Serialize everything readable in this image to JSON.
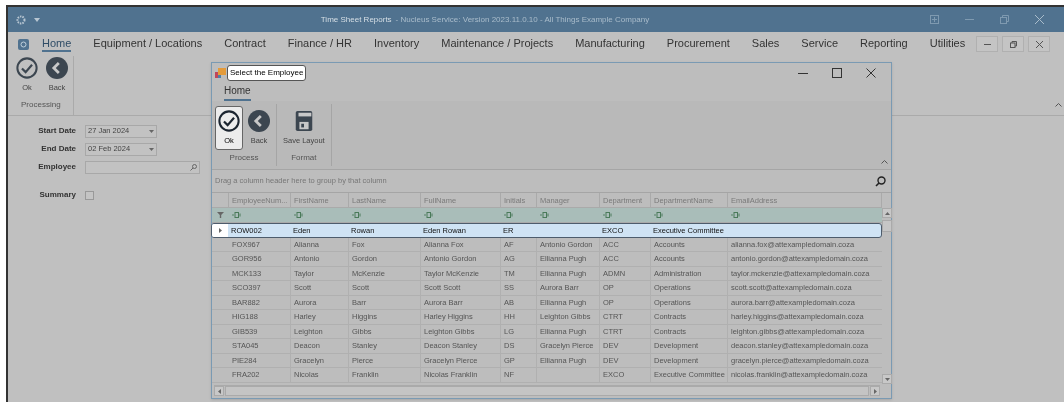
{
  "window": {
    "title": "Time Sheet Reports",
    "subtitle": "- Nucleus Service: Version 2023.11.0.10 - All Things Example Company"
  },
  "menu": [
    {
      "label": "Home",
      "selected": true
    },
    {
      "label": "Equipment / Locations",
      "selected": false
    },
    {
      "label": "Contract",
      "selected": false
    },
    {
      "label": "Finance / HR",
      "selected": false
    },
    {
      "label": "Inventory",
      "selected": false
    },
    {
      "label": "Maintenance / Projects",
      "selected": false
    },
    {
      "label": "Manufacturing",
      "selected": false
    },
    {
      "label": "Procurement",
      "selected": false
    },
    {
      "label": "Sales",
      "selected": false
    },
    {
      "label": "Service",
      "selected": false
    },
    {
      "label": "Reporting",
      "selected": false
    },
    {
      "label": "Utilities",
      "selected": false
    }
  ],
  "ribbon": {
    "buttons": [
      {
        "kind": "ok",
        "label": "Ok"
      },
      {
        "kind": "back",
        "label": "Back"
      }
    ],
    "group": "Processing"
  },
  "form": {
    "fields": [
      {
        "kind": "date",
        "label": "Start Date",
        "value": "27 Jan 2024"
      },
      {
        "kind": "date",
        "label": "End Date",
        "value": "02 Feb 2024"
      },
      {
        "kind": "search",
        "label": "Employee"
      },
      {
        "kind": "checkbox",
        "label": "Summary",
        "checked": false
      }
    ]
  },
  "dialog": {
    "title": "Select the Employee",
    "tab": {
      "label": "Home",
      "selected": true
    },
    "groups": [
      {
        "label": "Process",
        "buttons": [
          {
            "kind": "ok",
            "label": "Ok",
            "pressed": true
          },
          {
            "kind": "back",
            "label": "Back",
            "pressed": false
          }
        ]
      },
      {
        "label": "Format",
        "buttons": [
          {
            "kind": "save",
            "label": "Save Layout",
            "pressed": false
          }
        ]
      }
    ],
    "group_hint": "Drag a column header here to group by that column",
    "columns": [
      "EmployeeNum...",
      "FirstName",
      "LastName",
      "FullName",
      "Initials",
      "Manager",
      "Department",
      "DepartmentName",
      "EmailAddress"
    ],
    "rows": [
      {
        "selected": true,
        "cells": [
          "ROW002",
          "Eden",
          "Rowan",
          "Eden Rowan",
          "ER",
          "",
          "EXCO",
          "Executive Committee",
          ""
        ]
      },
      {
        "selected": false,
        "cells": [
          "FOX967",
          "Alianna",
          "Fox",
          "Alianna Fox",
          "AF",
          "Antonio Gordon",
          "ACC",
          "Accounts",
          "alianna.fox@attexampledomain.coza"
        ]
      },
      {
        "selected": false,
        "cells": [
          "GOR956",
          "Antonio",
          "Gordon",
          "Antonio Gordon",
          "AG",
          "Ellianna Pugh",
          "ACC",
          "Accounts",
          "antonio.gordon@attexampledomain.coza"
        ]
      },
      {
        "selected": false,
        "cells": [
          "MCK133",
          "Taylor",
          "McKenzie",
          "Taylor McKenzie",
          "TM",
          "Ellianna Pugh",
          "ADMN",
          "Administration",
          "taylor.mckenzie@attexampledomain.coza"
        ]
      },
      {
        "selected": false,
        "cells": [
          "SCO397",
          "Scott",
          "Scott",
          "Scott Scott",
          "SS",
          "Aurora Barr",
          "OP",
          "Operations",
          "scott.scott@attexampledomain.coza"
        ]
      },
      {
        "selected": false,
        "cells": [
          "BAR882",
          "Aurora",
          "Barr",
          "Aurora Barr",
          "AB",
          "Ellianna Pugh",
          "OP",
          "Operations",
          "aurora.barr@attexampledomain.coza"
        ]
      },
      {
        "selected": false,
        "cells": [
          "HIG188",
          "Harley",
          "Higgins",
          "Harley Higgins",
          "HH",
          "Leighton Gibbs",
          "CTRT",
          "Contracts",
          "harley.higgins@attexampledomain.coza"
        ]
      },
      {
        "selected": false,
        "cells": [
          "GIB539",
          "Leighton",
          "Gibbs",
          "Leighton Gibbs",
          "LG",
          "Ellianna Pugh",
          "CTRT",
          "Contracts",
          "leighton.gibbs@attexampledomain.coza"
        ]
      },
      {
        "selected": false,
        "cells": [
          "STA045",
          "Deacon",
          "Stanley",
          "Deacon Stanley",
          "DS",
          "Gracelyn Pierce",
          "DEV",
          "Development",
          "deacon.stanley@attexampledomain.coza"
        ]
      },
      {
        "selected": false,
        "cells": [
          "PIE284",
          "Gracelyn",
          "Pierce",
          "Gracelyn Pierce",
          "GP",
          "Ellianna Pugh",
          "DEV",
          "Development",
          "gracelyn.pierce@attexampledomain.coza"
        ]
      },
      {
        "selected": false,
        "cells": [
          "FRA202",
          "Nicolas",
          "Franklin",
          "Nicolas Franklin",
          "NF",
          "",
          "EXCO",
          "Executive Committee",
          "nicolas.franklin@attexampledomain.coza"
        ]
      }
    ]
  }
}
